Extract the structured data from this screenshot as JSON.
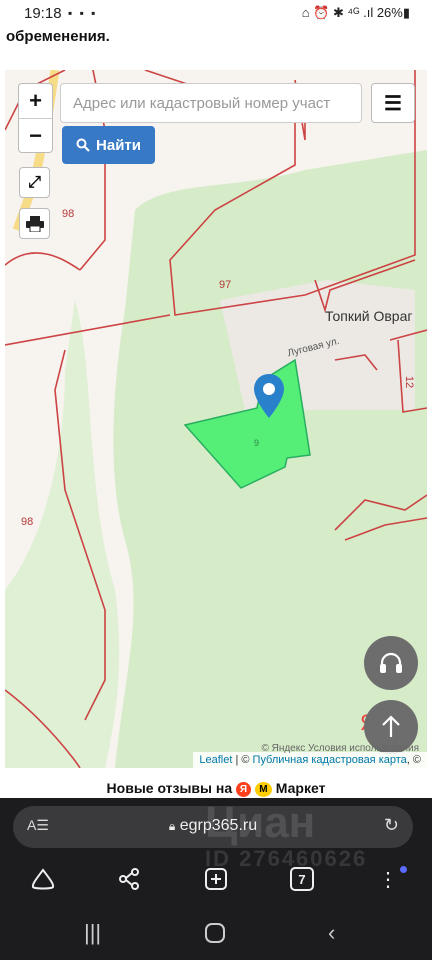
{
  "status_bar": {
    "time": "19:18",
    "notification_icons": "▪ ▪ ▪",
    "system_icons": "⌂ ⏰ ✱ ⁴ᴳ .ıl 26%▮"
  },
  "page": {
    "partial_text": "обременения."
  },
  "map": {
    "search_placeholder": "Адрес или кадастровый номер участ",
    "zoom_in": "+",
    "zoom_out": "−",
    "menu_icon": "☰",
    "find_label": "Найти",
    "place_name": "Топкий Овраг",
    "street_name": "Луговая ул.",
    "parcel_labels": [
      "98",
      "97",
      "98",
      "12",
      "9"
    ],
    "watermark_letter": "Я",
    "attribution": {
      "leaflet": "Leaflet",
      "separator": " | © ",
      "cadastral": "Публичная кадастровая карта",
      "suffix": ", ©",
      "yandex": "© Яндекс  Условия использования"
    },
    "colors": {
      "parcel_fill": "#55ee77",
      "parcel_border": "#c0392b",
      "marker": "#2a81cb",
      "forest": "#cfe8c0"
    }
  },
  "reviews": {
    "text_before": "Новые отзывы на",
    "yandex_badge": "Я",
    "market_badge": "М",
    "text_after": "Маркет"
  },
  "browser": {
    "url": "egrp365.ru",
    "tab_count": "7",
    "icons": [
      "home-icon",
      "share-icon",
      "new-tab-icon",
      "tabs-icon",
      "more-icon"
    ],
    "watermark_text": "Циан",
    "watermark_id": "ID 276460626"
  }
}
